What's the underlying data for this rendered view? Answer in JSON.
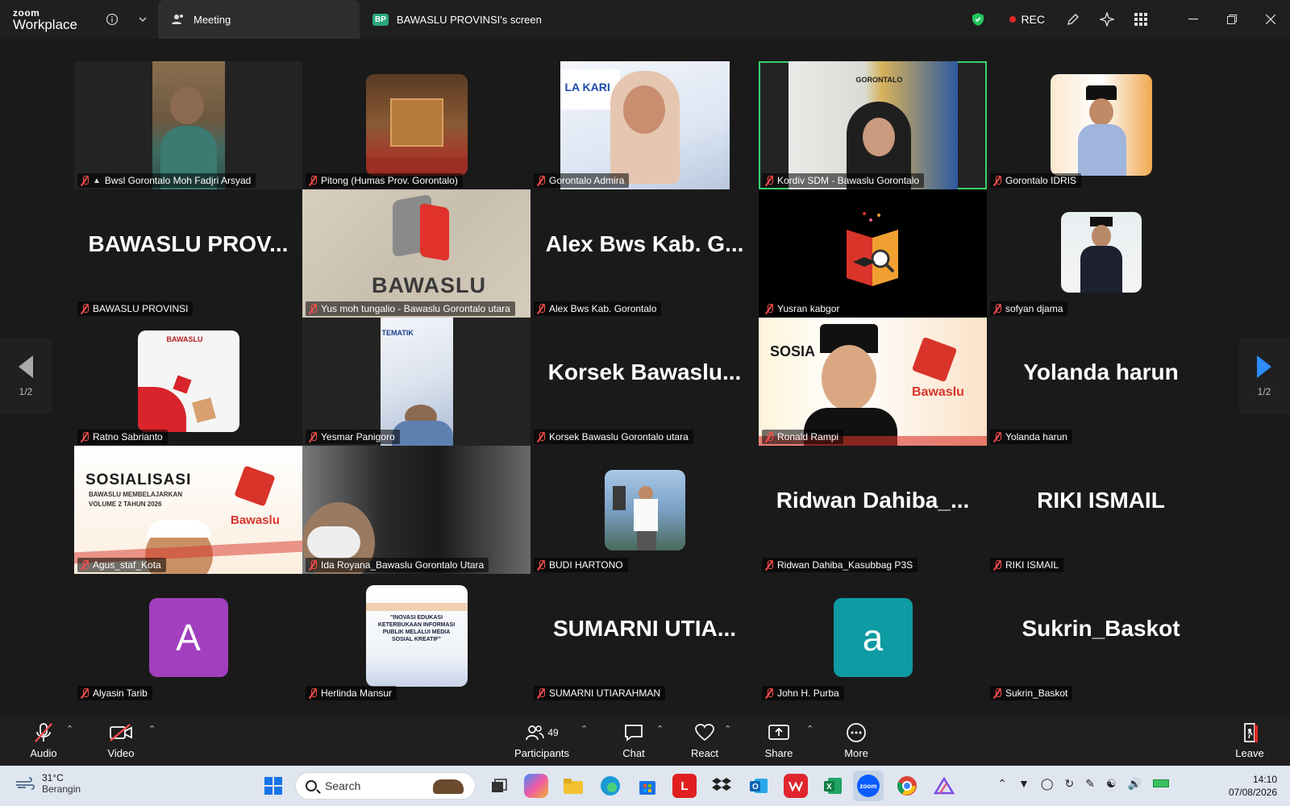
{
  "app": {
    "brand_top": "zoom",
    "brand_bottom": "Workplace"
  },
  "tabs": [
    {
      "label": "Meeting"
    },
    {
      "label": "BAWASLU PROVINSI's screen",
      "badge": "BP"
    }
  ],
  "titlebar": {
    "rec_label": "REC"
  },
  "pager": {
    "page": "1/2"
  },
  "participants": [
    {
      "name": "Bwsl Gorontalo Moh Fadjri Arsyad",
      "pinned": true,
      "type": "video"
    },
    {
      "name": "Pitong (Humas Prov. Gorontalo)",
      "type": "avatar"
    },
    {
      "name": "Gorontalo Admira",
      "type": "video"
    },
    {
      "name": "Kordiv SDM - Bawaslu Gorontalo",
      "type": "video",
      "active": true
    },
    {
      "name": "Gorontalo IDRIS",
      "type": "avatar"
    },
    {
      "name": "BAWASLU PROVINSI",
      "type": "text",
      "display": "BAWASLU  PROV..."
    },
    {
      "name": "Yus moh tungalio - Bawaslu Gorontalo utara",
      "type": "video",
      "overlay": "BAWASLU"
    },
    {
      "name": "Alex Bws Kab. Gorontalo",
      "type": "text",
      "display": "Alex Bws Kab. G..."
    },
    {
      "name": "Yusran kabgor",
      "type": "avatar"
    },
    {
      "name": "sofyan djama",
      "type": "avatar"
    },
    {
      "name": "Ratno Sabrianto",
      "type": "avatar",
      "overlay": "BAWASLU"
    },
    {
      "name": "Yesmar Panigoro",
      "type": "video",
      "overlay": "TEMATIK"
    },
    {
      "name": "Korsek Bawaslu Gorontalo utara",
      "type": "text",
      "display": "Korsek  Bawaslu..."
    },
    {
      "name": "Ronald Rampi",
      "type": "video",
      "overlay": "SOSIA",
      "overlay2": "Bawaslu"
    },
    {
      "name": "Yolanda harun",
      "type": "text",
      "display": "Yolanda harun"
    },
    {
      "name": "Agus_staf_Kota",
      "type": "video",
      "overlay": "SOSIALISASI",
      "overlay2": "BAWASLU MEMBELAJARKAN",
      "overlay3": "VOLUME 2 TAHUN 2026",
      "overlay4": "Bawaslu"
    },
    {
      "name": "Ida Royana_Bawaslu Gorontalo Utara",
      "type": "video"
    },
    {
      "name": "BUDI HARTONO",
      "type": "avatar"
    },
    {
      "name": "Ridwan Dahiba_Kasubbag P3S",
      "type": "text",
      "display": "Ridwan  Dahiba_..."
    },
    {
      "name": "RIKI ISMAIL",
      "type": "text",
      "display": "RIKI ISMAIL"
    },
    {
      "name": "Alyasin Tarib",
      "type": "letter",
      "letter": "A",
      "color": "#a13fbf"
    },
    {
      "name": "Herlinda Mansur",
      "type": "avatar",
      "overlay": "\"INOVASI EDUKASI KETERBUKAAN INFORMASI PUBLIK MELALUI MEDIA SOSIAL KREATIF\""
    },
    {
      "name": "SUMARNI UTIARAHMAN",
      "type": "text",
      "display": "SUMARNI  UTIA..."
    },
    {
      "name": "John H. Purba",
      "type": "letter",
      "letter": "a",
      "color": "#0e9ba3"
    },
    {
      "name": "Sukrin_Baskot",
      "type": "text",
      "display": "Sukrin_Baskot"
    }
  ],
  "toolbar": {
    "audio": "Audio",
    "video": "Video",
    "participants": "Participants",
    "participants_count": "49",
    "chat": "Chat",
    "react": "React",
    "share": "Share",
    "more": "More",
    "leave": "Leave"
  },
  "taskbar": {
    "temperature": "31°C",
    "weather": "Berangin",
    "search_placeholder": "Search",
    "time": "14:10",
    "date": "07/08/2026"
  },
  "colors": {
    "accent": "#2d8cff",
    "active_speaker": "#3ad06f",
    "rec": "#e02828"
  }
}
